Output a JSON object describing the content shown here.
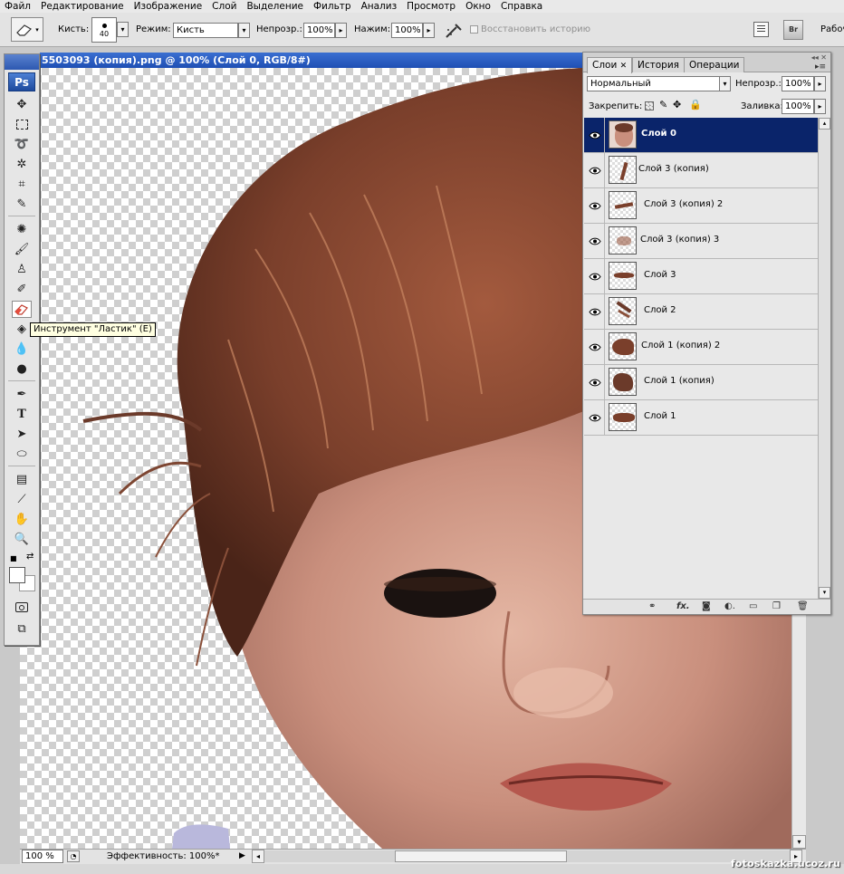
{
  "menu": [
    "Файл",
    "Редактирование",
    "Изображение",
    "Слой",
    "Выделение",
    "Фильтр",
    "Анализ",
    "Просмотр",
    "Окно",
    "Справка"
  ],
  "options": {
    "brush_label": "Кисть:",
    "brush_size": "40",
    "mode_label": "Режим:",
    "mode_value": "Кисть",
    "opacity_label": "Непрозр.:",
    "opacity_value": "100%",
    "pressure_label": "Нажим:",
    "pressure_value": "100%",
    "restore_history": "Восстановить историю",
    "workspace_label": "Рабоч"
  },
  "document": {
    "title": "5503093 (копия).png @ 100% (Слой 0, RGB/8#)",
    "zoom": "100 %",
    "status": "Эффективность: 100%*"
  },
  "tooltip": "Инструмент \"Ластик\" (E)",
  "toolbox": {
    "logo": "Ps"
  },
  "panel": {
    "tabs": [
      "Слои",
      "История",
      "Операции"
    ],
    "blend_mode": "Нормальный",
    "opacity_label": "Непрозр.:",
    "opacity_value": "100%",
    "lock_label": "Закрепить:",
    "fill_label": "Заливка:",
    "fill_value": "100%",
    "layers": [
      {
        "name": "Слой 0",
        "selected": true
      },
      {
        "name": "Слой 3 (копия)",
        "selected": false
      },
      {
        "name": "Слой 3 (копия) 2",
        "selected": false
      },
      {
        "name": "Слой 3 (копия) 3",
        "selected": false
      },
      {
        "name": "Слой 3",
        "selected": false
      },
      {
        "name": "Слой 2",
        "selected": false
      },
      {
        "name": "Слой 1 (копия) 2",
        "selected": false
      },
      {
        "name": "Слой 1 (копия)",
        "selected": false
      },
      {
        "name": "Слой 1",
        "selected": false
      }
    ]
  },
  "watermark": "fotoskazka.ucoz.ru"
}
